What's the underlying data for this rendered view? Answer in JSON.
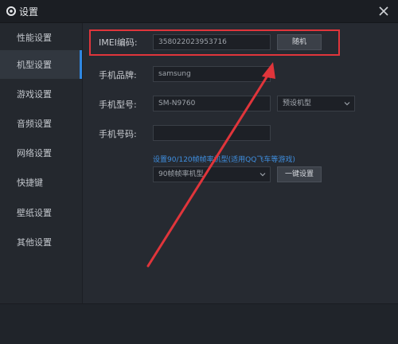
{
  "window": {
    "title": "设置"
  },
  "icons": {
    "app": "gear-icon",
    "close": "close-icon",
    "caret": "chevron-down-icon"
  },
  "sidebar": {
    "items": [
      {
        "label": "性能设置"
      },
      {
        "label": "机型设置",
        "active": true
      },
      {
        "label": "游戏设置"
      },
      {
        "label": "音频设置"
      },
      {
        "label": "网络设置"
      },
      {
        "label": "快捷键"
      },
      {
        "label": "壁纸设置"
      },
      {
        "label": "其他设置"
      }
    ]
  },
  "form": {
    "imei": {
      "label": "IMEI编码:",
      "value": "358022023953716",
      "button": "随机"
    },
    "brand": {
      "label": "手机品牌:",
      "value": "samsung"
    },
    "model": {
      "label": "手机型号:",
      "value": "SM-N9760",
      "preset": "预设机型"
    },
    "phone": {
      "label": "手机号码:",
      "value": ""
    },
    "fps": {
      "link": "设置90/120帧帧率机型(适用QQ飞车等游戏)",
      "select": "90帧帧率机型",
      "button": "一键设置"
    }
  },
  "colors": {
    "accent": "#2f87e2",
    "highlight": "#e0353b"
  }
}
